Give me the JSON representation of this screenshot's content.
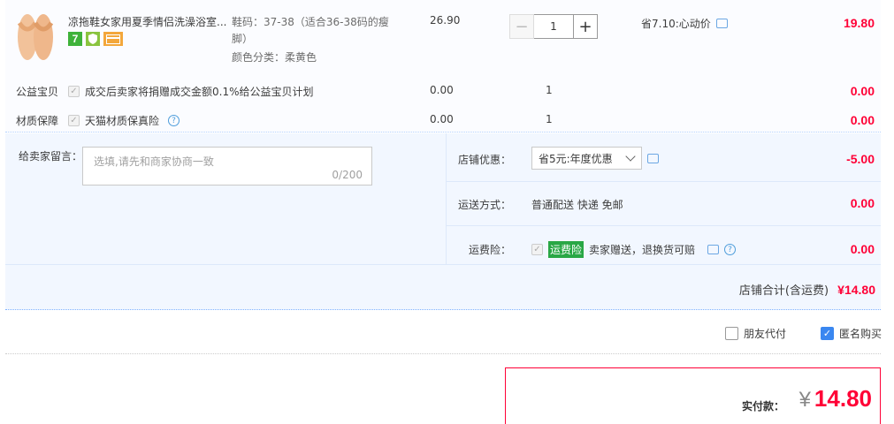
{
  "item": {
    "title": "凉拖鞋女家用夏季情侣洗澡浴室...",
    "badge_seven": "7",
    "spec_size": "鞋码：37-38（适合36-38码的瘦",
    "spec_size_cont": "脚）",
    "spec_color": "颜色分类：柔黄色",
    "unit_price": "26.90",
    "quantity": "1",
    "promo": "省7.10:心动价",
    "subtotal": "19.80"
  },
  "extras": [
    {
      "label": "公益宝贝",
      "desc": "成交后卖家将捐赠成交金额0.1%给公益宝贝计划",
      "price": "0.00",
      "qty": "1",
      "total": "0.00"
    },
    {
      "label": "材质保障",
      "desc": "天猫材质保真险",
      "price": "0.00",
      "qty": "1",
      "total": "0.00"
    }
  ],
  "shop": {
    "message_label": "给卖家留言：",
    "message_placeholder": "选填,请先和商家协商一致",
    "message_count": "0/200",
    "coupon_label": "店铺优惠：",
    "coupon_value": "省5元:年度优惠",
    "coupon_amount": "-5.00",
    "shipping_label": "运送方式：",
    "shipping_value": "普通配送 快递 免邮",
    "shipping_amount": "0.00",
    "insurance_label": "运费险：",
    "insurance_tag": "运费险",
    "insurance_desc": "卖家赠送，退换货可赔",
    "insurance_amount": "0.00",
    "total_label": "店铺合计(含运费)",
    "total_value": "¥14.80"
  },
  "options": {
    "friend_pay": "朋友代付",
    "anonymous": "匿名购买"
  },
  "payment": {
    "label": "实付款：",
    "currency": "¥",
    "amount": "14.80"
  },
  "colors": {
    "accent_red": "#ff0036",
    "check_blue": "#3a87f0",
    "insurance_green": "#29a745"
  }
}
